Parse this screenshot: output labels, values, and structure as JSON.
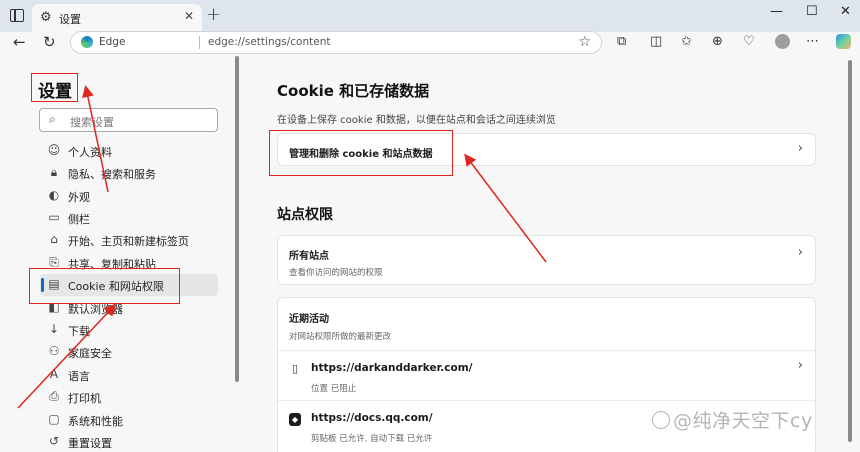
{
  "window": {
    "tab_title": "设置",
    "tab_close": "✕",
    "new_tab": "+",
    "minimize": "—",
    "maximize": "☐",
    "close": "✕"
  },
  "address_bar": {
    "site_label": "Edge",
    "url": "edge://settings/content"
  },
  "sidebar": {
    "title": "设置",
    "search_placeholder": "搜索设置",
    "items": [
      {
        "label": "个人资料",
        "icon": "profile-icon"
      },
      {
        "label": "隐私、搜索和服务",
        "icon": "lock-icon"
      },
      {
        "label": "外观",
        "icon": "appearance-icon"
      },
      {
        "label": "侧栏",
        "icon": "sidebar-icon"
      },
      {
        "label": "开始、主页和新建标签页",
        "icon": "home-icon"
      },
      {
        "label": "共享、复制和粘贴",
        "icon": "share-icon"
      },
      {
        "label": "Cookie 和网站权限",
        "icon": "cookie-icon",
        "active": true
      },
      {
        "label": "默认浏览器",
        "icon": "browser-icon"
      },
      {
        "label": "下载",
        "icon": "download-icon"
      },
      {
        "label": "家庭安全",
        "icon": "family-icon"
      },
      {
        "label": "语言",
        "icon": "language-icon"
      },
      {
        "label": "打印机",
        "icon": "printer-icon"
      },
      {
        "label": "系统和性能",
        "icon": "system-icon"
      },
      {
        "label": "重置设置",
        "icon": "reset-icon"
      }
    ]
  },
  "main": {
    "cookie_section_title": "Cookie 和已存储数据",
    "cookie_section_desc": "在设备上保存 cookie 和数据，以便在站点和会话之间连续浏览",
    "manage_cookies_label": "管理和删除 cookie 和站点数据",
    "permissions_title": "站点权限",
    "all_sites_title": "所有站点",
    "all_sites_desc": "查看你访问的网站的权限",
    "recent_title": "近期活动",
    "recent_desc": "对网站权限所做的最新更改",
    "recent_sites": [
      {
        "url": "https://darkanddarker.com/",
        "perms": "位置 已阻止"
      },
      {
        "url": "https://docs.qq.com/",
        "perms": "剪贴板 已允许, 自动下载 已允许"
      }
    ]
  },
  "watermark": "@纯净天空下cy",
  "colors": {
    "accent": "#0f6cbd",
    "annotation_red": "#e0261e"
  }
}
